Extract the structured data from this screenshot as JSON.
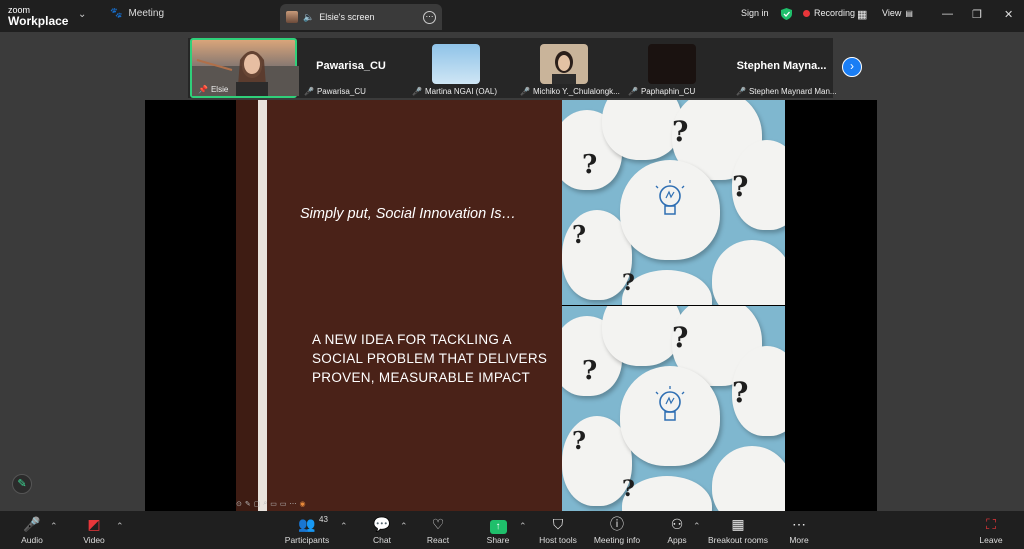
{
  "app": {
    "logo_top": "zoom",
    "logo_bottom": "Workplace",
    "meeting_label": "Meeting"
  },
  "share_tab": {
    "label": "Elsie's screen"
  },
  "titlebar": {
    "sign_in": "Sign in",
    "recording": "Recording",
    "view": "View"
  },
  "participants_strip": {
    "tiles": [
      {
        "name": "Elsie",
        "big": ""
      },
      {
        "name": "Pawarisa_CU",
        "big": "Pawarisa_CU"
      },
      {
        "name": "Martina NGAI (OAL)",
        "big": ""
      },
      {
        "name": "Michiko Y._Chulalongk...",
        "big": ""
      },
      {
        "name": "Paphaphin_CU",
        "big": ""
      },
      {
        "name": "Stephen Maynard Man...",
        "big": "Stephen Mayna..."
      }
    ]
  },
  "slide": {
    "heading": "Simply put, Social Innovation Is…",
    "body": "A NEW IDEA FOR TACKLING A SOCIAL PROBLEM THAT DELIVERS PROVEN, MEASURABLE IMPACT"
  },
  "toolbar": {
    "audio": "Audio",
    "video": "Video",
    "participants": "Participants",
    "participants_count": "43",
    "chat": "Chat",
    "react": "React",
    "share": "Share",
    "host_tools": "Host tools",
    "meeting_info": "Meeting info",
    "apps": "Apps",
    "breakout_rooms": "Breakout rooms",
    "more": "More",
    "leave": "Leave"
  },
  "colors": {
    "accent": "#1a7ef5",
    "recording": "#e8363a",
    "share": "#1fbf6b",
    "slide_bg": "#4a2218"
  }
}
